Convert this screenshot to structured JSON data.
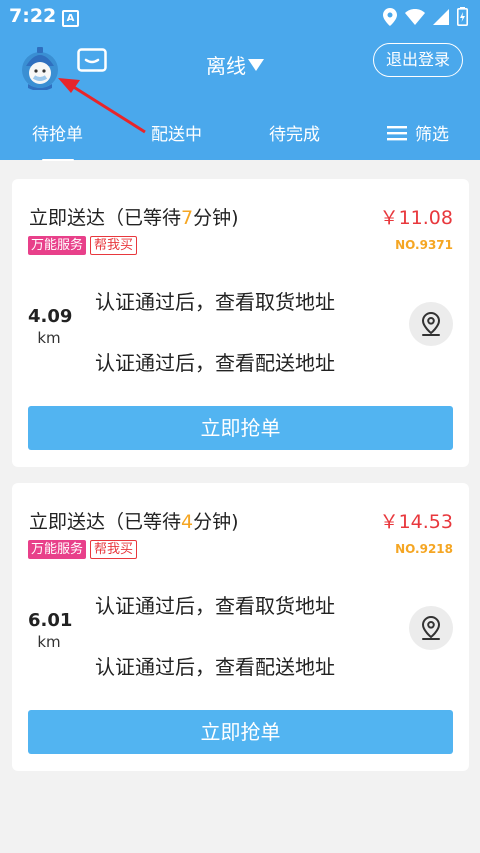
{
  "statusbar": {
    "time": "7:22",
    "notif_badge": "A"
  },
  "header": {
    "status_label": "离线",
    "logout_label": "退出登录"
  },
  "tabs": [
    {
      "label": "待抢单",
      "active": true
    },
    {
      "label": "配送中",
      "active": false
    },
    {
      "label": "待完成",
      "active": false
    },
    {
      "label": "筛选",
      "active": false
    }
  ],
  "orders": [
    {
      "title_prefix": "立即送达（已等待",
      "wait_minutes": "7",
      "title_suffix": "分钟)",
      "price": "￥11.08",
      "tags": [
        "万能服务",
        "帮我买"
      ],
      "order_no": "NO.9371",
      "distance": "4.09",
      "distance_unit": "km",
      "pickup_text": "认证通过后，查看取货地址",
      "delivery_text": "认证通过后，查看配送地址",
      "action_label": "立即抢单"
    },
    {
      "title_prefix": "立即送达（已等待",
      "wait_minutes": "4",
      "title_suffix": "分钟)",
      "price": "￥14.53",
      "tags": [
        "万能服务",
        "帮我买"
      ],
      "order_no": "NO.9218",
      "distance": "6.01",
      "distance_unit": "km",
      "pickup_text": "认证通过后，查看取货地址",
      "delivery_text": "认证通过后，查看配送地址",
      "action_label": "立即抢单"
    }
  ],
  "colors": {
    "primary": "#4aa8ec",
    "button": "#52b4f1",
    "price": "#e8383d",
    "wait": "#f5a623",
    "tag_service": "#e8408a"
  }
}
